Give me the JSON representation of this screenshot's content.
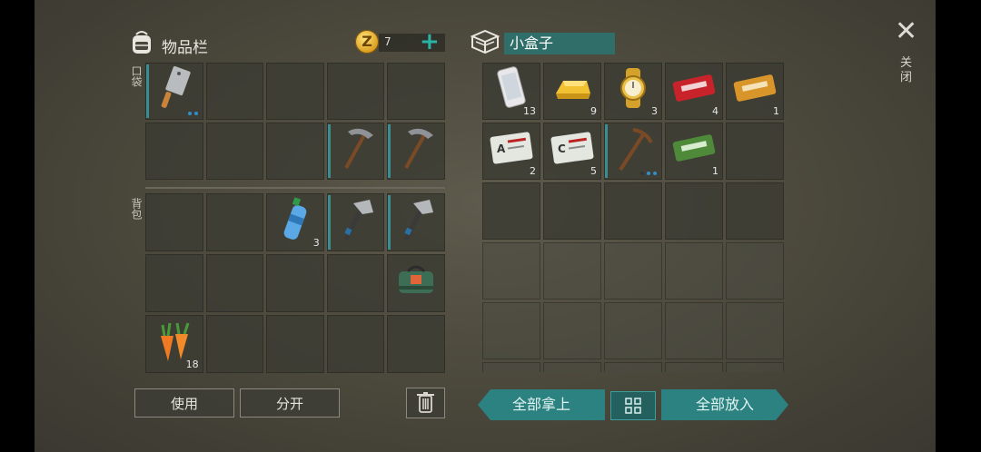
{
  "inventory": {
    "title": "物品栏",
    "coins": "7",
    "pocket_label": "口袋",
    "backpack_label": "背包",
    "pocket_slots": [
      {
        "item": "cleaver",
        "count": "",
        "dots": true
      },
      {
        "item": "",
        "count": ""
      },
      {
        "item": "",
        "count": ""
      },
      {
        "item": "",
        "count": ""
      },
      {
        "item": "",
        "count": ""
      },
      {
        "item": "",
        "count": ""
      },
      {
        "item": "",
        "count": ""
      },
      {
        "item": "",
        "count": ""
      },
      {
        "item": "pickaxe",
        "count": ""
      },
      {
        "item": "pickaxe",
        "count": ""
      }
    ],
    "backpack_slots": [
      {
        "item": "",
        "count": ""
      },
      {
        "item": "",
        "count": ""
      },
      {
        "item": "water-bottle",
        "count": "3"
      },
      {
        "item": "hatchet",
        "count": ""
      },
      {
        "item": "hatchet",
        "count": ""
      },
      {
        "item": "",
        "count": ""
      },
      {
        "item": "",
        "count": ""
      },
      {
        "item": "",
        "count": ""
      },
      {
        "item": "",
        "count": ""
      },
      {
        "item": "green-bag",
        "count": ""
      },
      {
        "item": "carrots",
        "count": "18"
      },
      {
        "item": "",
        "count": ""
      },
      {
        "item": "",
        "count": ""
      },
      {
        "item": "",
        "count": ""
      },
      {
        "item": "",
        "count": ""
      }
    ],
    "use_label": "使用",
    "split_label": "分开"
  },
  "box": {
    "name": "小盒子",
    "slots_row1": [
      {
        "item": "phone",
        "count": "13"
      },
      {
        "item": "gold-bar",
        "count": "9"
      },
      {
        "item": "gold-watch",
        "count": "3"
      },
      {
        "item": "red-coupon",
        "count": "4"
      },
      {
        "item": "orange-coupon",
        "count": "1"
      }
    ],
    "slots_row2": [
      {
        "item": "army-card-a",
        "count": "2"
      },
      {
        "item": "army-card-c",
        "count": "5"
      },
      {
        "item": "wood-pickaxe",
        "count": ""
      },
      {
        "item": "green-coupon",
        "count": "1"
      },
      {
        "item": "",
        "count": ""
      }
    ],
    "take_all_label": "全部拿上",
    "put_all_label": "全部放入"
  },
  "close_label": "关闭",
  "colors": {
    "accent": "#2c8280",
    "coin": "#e0a020"
  }
}
